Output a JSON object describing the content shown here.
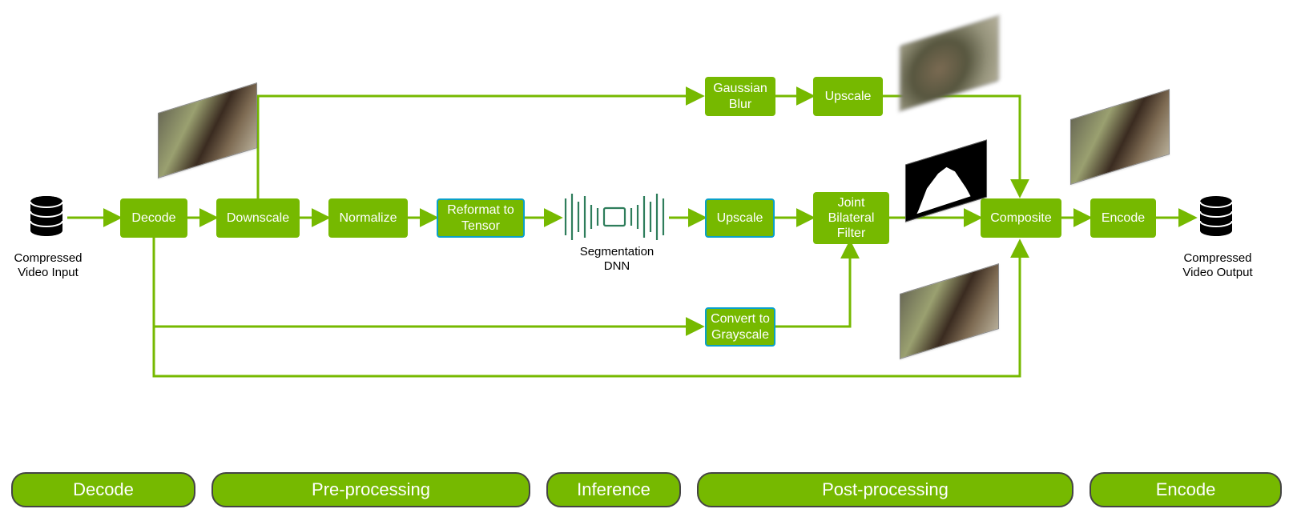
{
  "io": {
    "input_label": "Compressed\nVideo Input",
    "output_label": "Compressed\nVideo Output"
  },
  "nodes": {
    "decode": "Decode",
    "downscale": "Downscale",
    "normalize": "Normalize",
    "reformat": "Reformat to\nTensor",
    "segdnn": "Segmentation\nDNN",
    "upscale_main": "Upscale",
    "jbf": "Joint\nBilateral\nFilter",
    "gauss": "Gaussian\nBlur",
    "upscale_top": "Upscale",
    "grayscale": "Convert to\nGrayscale",
    "composite": "Composite",
    "encode": "Encode"
  },
  "stages": {
    "decode": "Decode",
    "pre": "Pre-processing",
    "infer": "Inference",
    "post": "Post-processing",
    "encode": "Encode"
  },
  "colors": {
    "accent": "#76b900",
    "outline": "#0aa0c8"
  }
}
